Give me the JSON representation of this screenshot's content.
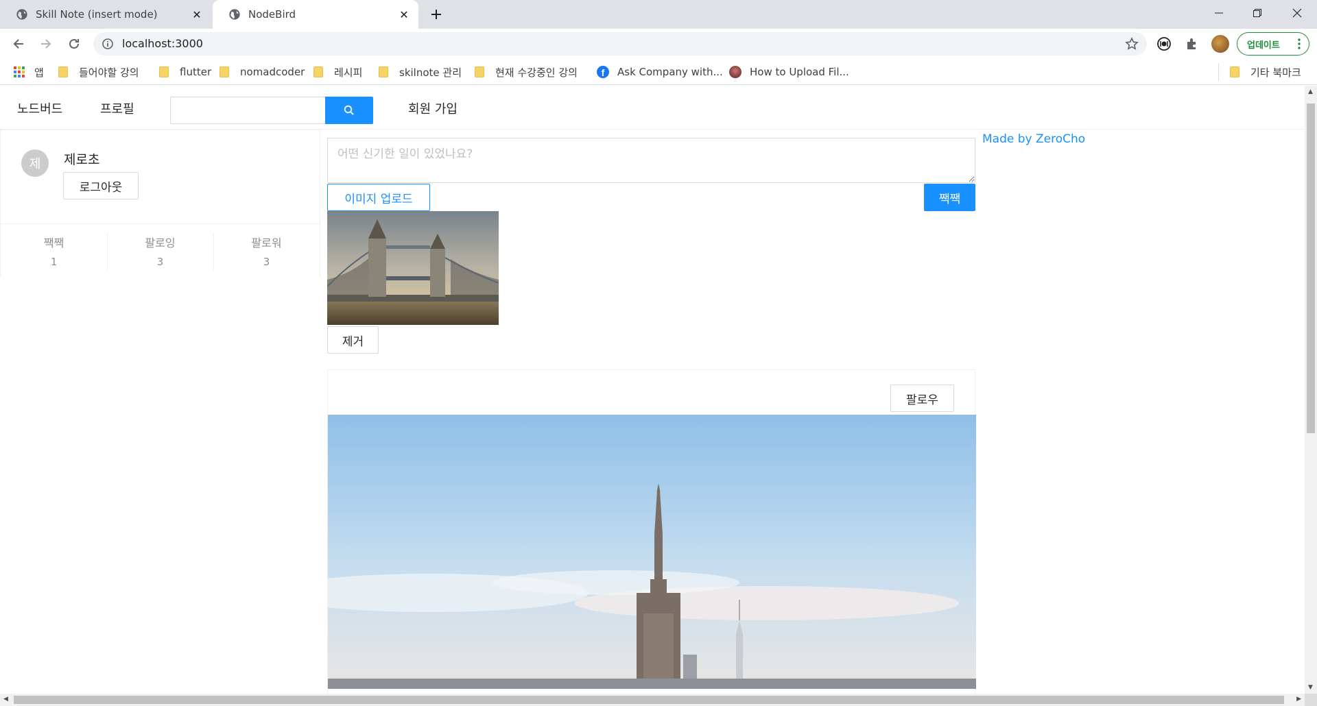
{
  "browser": {
    "tabs": [
      {
        "title": "Skill Note (insert mode)",
        "active": false
      },
      {
        "title": "NodeBird",
        "active": true
      }
    ],
    "url": "localhost:3000",
    "update_label": "업데이트",
    "bookmarks": [
      {
        "label": "앱",
        "icon": "apps-icon"
      },
      {
        "label": "들어야할 강의",
        "icon": "folder-icon"
      },
      {
        "label": "flutter",
        "icon": "folder-icon"
      },
      {
        "label": "nomadcoder",
        "icon": "folder-icon"
      },
      {
        "label": "레시피",
        "icon": "folder-icon"
      },
      {
        "label": "skilnote 관리",
        "icon": "folder-icon"
      },
      {
        "label": "현재 수강중인 강의",
        "icon": "folder-icon"
      },
      {
        "label": "Ask Company with...",
        "icon": "facebook-icon"
      },
      {
        "label": "How to Upload Fil...",
        "icon": "site-icon"
      },
      {
        "label": "기타 북마크",
        "icon": "folder-icon"
      }
    ]
  },
  "menu": {
    "home": "노드버드",
    "profile": "프로필",
    "search_value": "",
    "signup": "회원 가입"
  },
  "user_card": {
    "avatar_initial": "제",
    "nickname": "제로초",
    "logout_label": "로그아웃",
    "stats": [
      {
        "label": "짹짹",
        "value": "1"
      },
      {
        "label": "팔로잉",
        "value": "3"
      },
      {
        "label": "팔로워",
        "value": "3"
      }
    ]
  },
  "post_form": {
    "placeholder": "어떤 신기한 일이 있었나요?",
    "upload_label": "이미지 업로드",
    "submit_label": "짹짹",
    "remove_label": "제거"
  },
  "sidebar_right": {
    "made_by": "Made by ZeroCho"
  },
  "post": {
    "follow_label": "팔로우"
  },
  "colors": {
    "primary": "#1890ff",
    "chrome_tabstrip": "#dee1e6",
    "update_green": "#1e8e3e"
  }
}
